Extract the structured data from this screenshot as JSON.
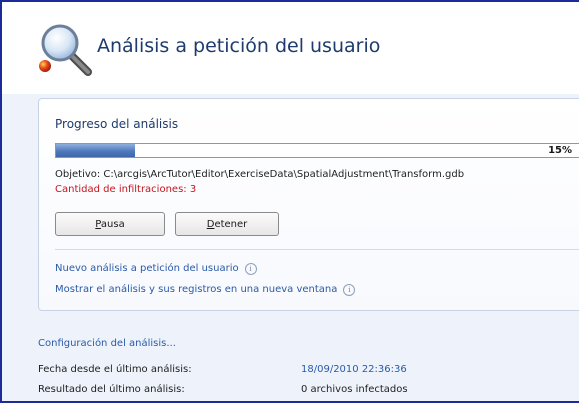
{
  "header": {
    "title": "Análisis a petición del usuario",
    "icon": "magnifier-icon"
  },
  "progress_panel": {
    "title": "Progreso del análisis",
    "progress_percent": 15,
    "progress_label": "15%",
    "target_text": "Objetivo: C:\\arcgis\\ArcTutor\\Editor\\ExerciseData\\SpatialAdjustment\\Transform.gdb",
    "infiltrations_text": "Cantidad de infiltraciones: 3",
    "pause_button": {
      "label_accel": "P",
      "label_rest": "ausa"
    },
    "stop_button": {
      "label_accel": "D",
      "label_rest": "etener"
    },
    "links": [
      {
        "label": "Nuevo análisis a petición del usuario"
      },
      {
        "label": "Mostrar el análisis y sus registros en una nueva ventana"
      }
    ]
  },
  "config": {
    "link_label": "Configuración del análisis...",
    "last_scan_date_label": "Fecha desde el último análisis:",
    "last_scan_date_value": "18/09/2010 22:36:36",
    "last_scan_result_label": "Resultado del último análisis:",
    "last_scan_result_value": "0 archivos infectados"
  },
  "colors": {
    "accent": "#2a5aa8",
    "warning": "#c4151c",
    "title": "#1e3b6e",
    "progress": "#4f79bd"
  }
}
